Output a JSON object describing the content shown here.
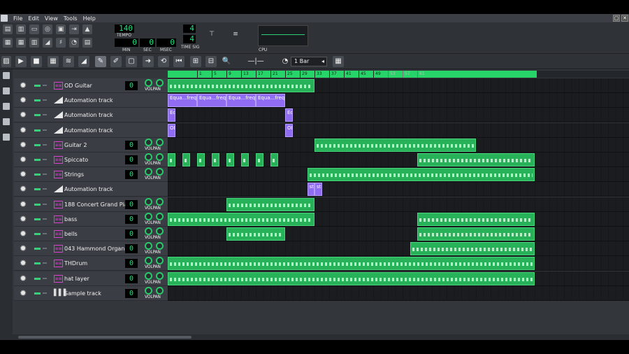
{
  "menu": {
    "items": [
      "File",
      "Edit",
      "View",
      "Tools",
      "Help"
    ]
  },
  "window_buttons": [
    "▢",
    "✕"
  ],
  "toolbar": {
    "tempo": "140",
    "tempo_label": "TEMPO",
    "time_min": "0",
    "time_sec": "0",
    "time_msec": "0",
    "min_label": "MIN",
    "sec_label": "SEC",
    "msec_label": "MSEC",
    "timesig_num": "4",
    "timesig_den": "4",
    "timesig_label": "TIME SIG",
    "cpu_label": "CPU"
  },
  "song_editor": {
    "zoom": "1 Bar"
  },
  "ruler": [
    "1",
    "5",
    "9",
    "13",
    "17",
    "21",
    "25",
    "29",
    "33",
    "37",
    "41",
    "45",
    "49",
    "53",
    "57",
    "61"
  ],
  "tracks": [
    {
      "name": "OD Guitar",
      "type": "inst",
      "volume": "0",
      "vol_label": "VOL",
      "pan_label": "PAN"
    },
    {
      "name": "Automation track",
      "type": "auto"
    },
    {
      "name": "Automation track",
      "type": "auto"
    },
    {
      "name": "Automation track",
      "type": "auto"
    },
    {
      "name": "Guitar 2",
      "type": "inst",
      "volume": "0",
      "vol_label": "VOL",
      "pan_label": "PAN"
    },
    {
      "name": "Spiccato",
      "type": "inst",
      "volume": "0",
      "vol_label": "VOL",
      "pan_label": "PAN"
    },
    {
      "name": "Strings",
      "type": "inst",
      "volume": "0",
      "vol_label": "VOL",
      "pan_label": "PAN"
    },
    {
      "name": "Automation track",
      "type": "auto"
    },
    {
      "name": "188 Concert Grand Piano",
      "type": "inst",
      "volume": "0",
      "vol_label": "VOL",
      "pan_label": "PAN"
    },
    {
      "name": "bass",
      "type": "inst",
      "volume": "0",
      "vol_label": "VOL",
      "pan_label": "PAN"
    },
    {
      "name": "bells",
      "type": "inst",
      "volume": "0",
      "vol_label": "VOL",
      "pan_label": "PAN"
    },
    {
      "name": "043 Hammond Organ",
      "type": "inst",
      "volume": "0",
      "vol_label": "VOL",
      "pan_label": "PAN"
    },
    {
      "name": "THDrum",
      "type": "inst",
      "volume": "0",
      "vol_label": "VOL",
      "pan_label": "PAN"
    },
    {
      "name": "hat layer",
      "type": "inst",
      "volume": "0",
      "vol_label": "VOL",
      "pan_label": "PAN"
    },
    {
      "name": "Sample track",
      "type": "sample",
      "volume": "0",
      "vol_label": "VOL",
      "pan_label": "PAN"
    }
  ],
  "auto_clip_labels": {
    "equa": "Equa...freq",
    "ec": "Ec",
    "od": "OD",
    "st": "st"
  },
  "colors": {
    "accent": "#27d469",
    "clip": "#27b259",
    "automation": "#8f6cf2",
    "instrument_icon": "#e23bd6"
  }
}
